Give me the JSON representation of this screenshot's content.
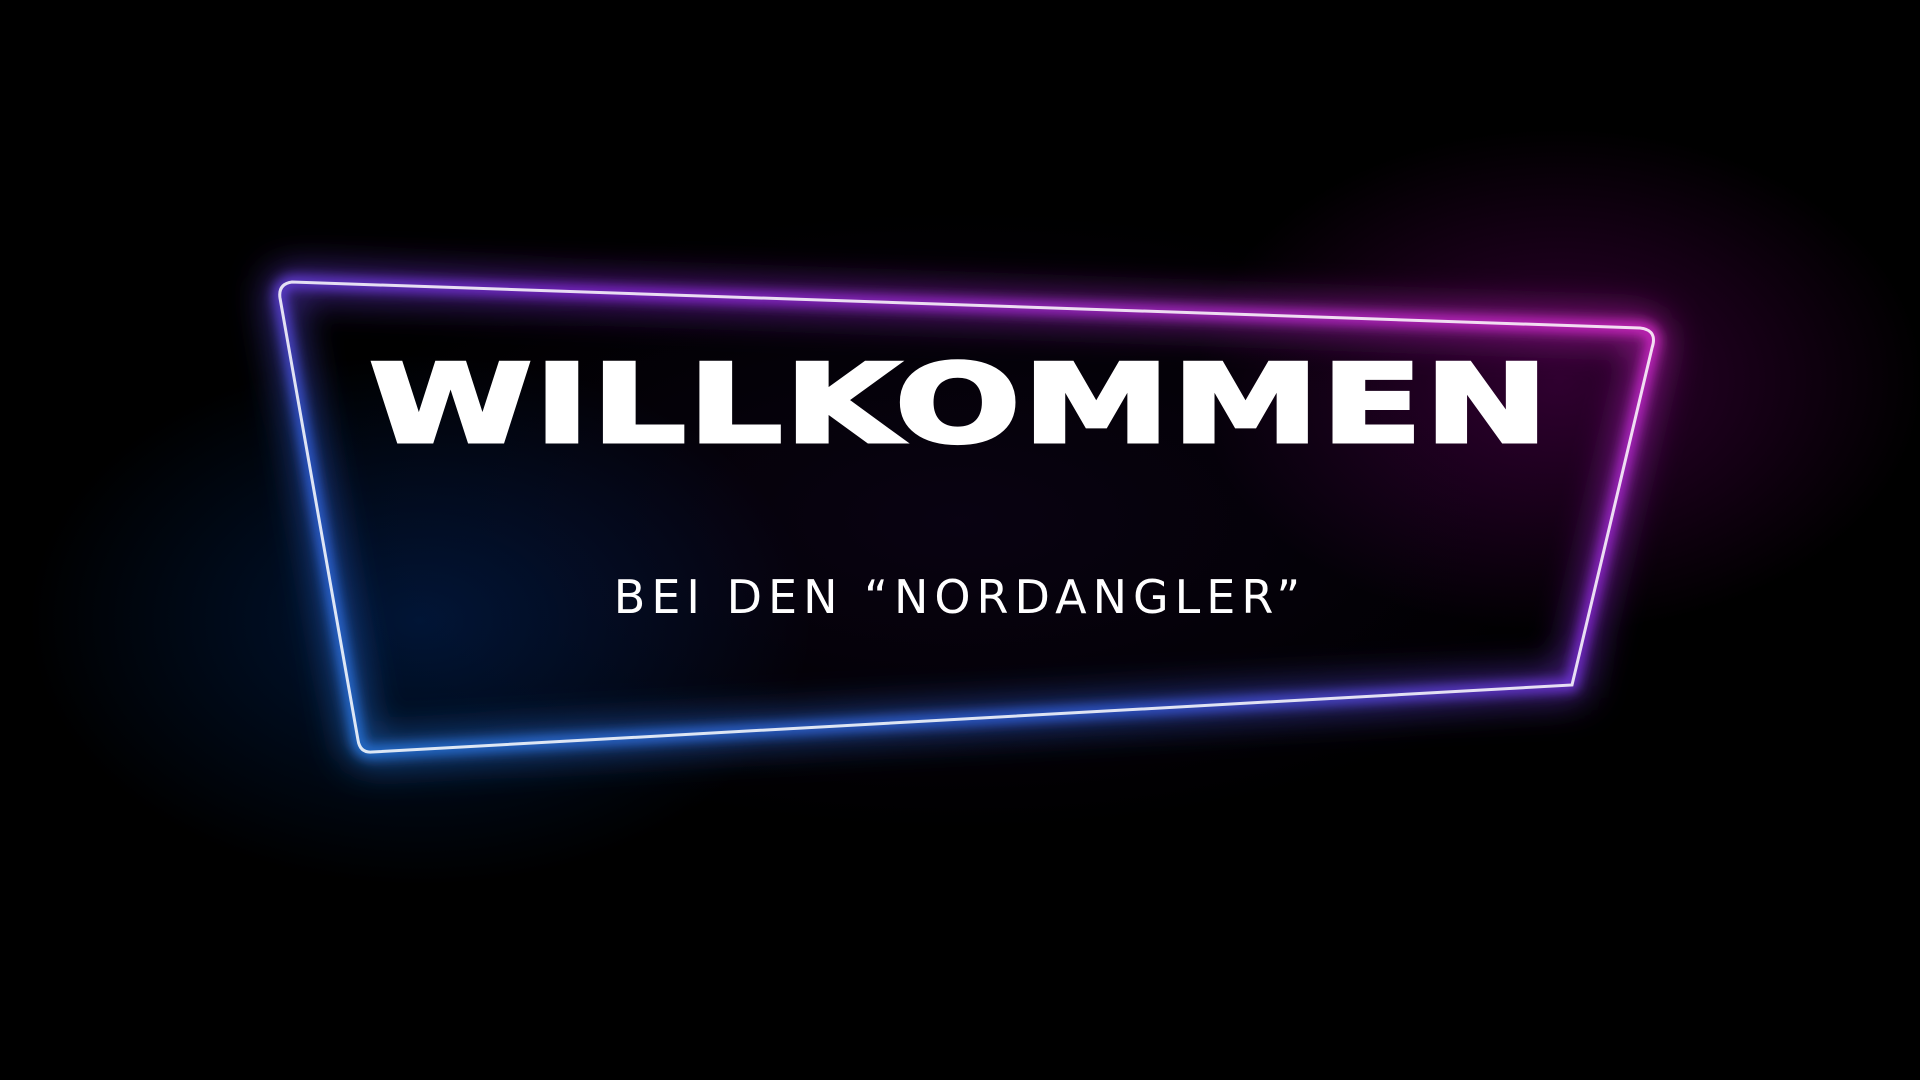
{
  "sign": {
    "headline": "WILLKOMMEN",
    "subline": "BEI DEN “NORDANGLER”"
  },
  "colors": {
    "background": "#000000",
    "neon_blue": "#3aa0ff",
    "neon_pink": "#ff2ee0",
    "text": "#ffffff"
  }
}
